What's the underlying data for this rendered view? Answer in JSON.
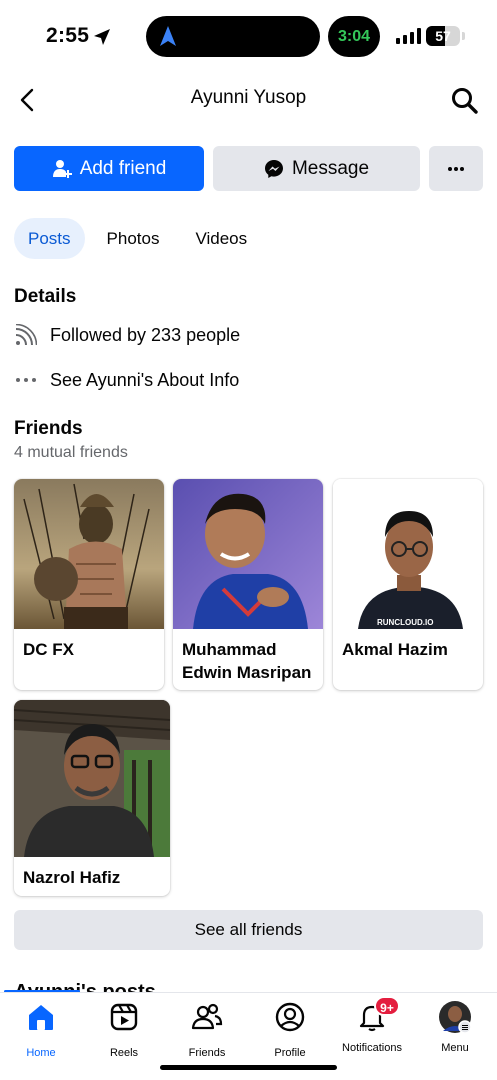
{
  "status_bar": {
    "time": "2:55",
    "timer": "3:04",
    "battery": "57",
    "battery_level": 0.57
  },
  "header": {
    "title": "Ayunni Yusop"
  },
  "actions": {
    "add_friend": "Add friend",
    "message": "Message"
  },
  "tabs": [
    {
      "label": "Posts",
      "active": true
    },
    {
      "label": "Photos"
    },
    {
      "label": "Videos"
    }
  ],
  "details": {
    "title": "Details",
    "followed": "Followed by 233 people",
    "about": "See Ayunni's About Info"
  },
  "friends": {
    "title": "Friends",
    "mutual": "4 mutual friends",
    "items": [
      {
        "name": "DC FX"
      },
      {
        "name_line1": "Muhammad",
        "name_line2": "Edwin Masripan"
      },
      {
        "name": "Akmal Hazim",
        "shirt_text": "RUNCLOUD.IO"
      },
      {
        "name": "Nazrol Hafiz"
      }
    ],
    "see_all": "See all friends"
  },
  "posts_heading": "Ayunni's posts",
  "bottom_nav": {
    "items": [
      {
        "label": "Home",
        "active": true
      },
      {
        "label": "Reels"
      },
      {
        "label": "Friends"
      },
      {
        "label": "Profile"
      },
      {
        "label": "Notifications",
        "badge": "9+"
      },
      {
        "label": "Menu"
      }
    ]
  },
  "colors": {
    "accent": "#0866ff",
    "button_gray": "#e4e6eb",
    "badge_red": "#e41e3f",
    "timer_green": "#34c759"
  }
}
